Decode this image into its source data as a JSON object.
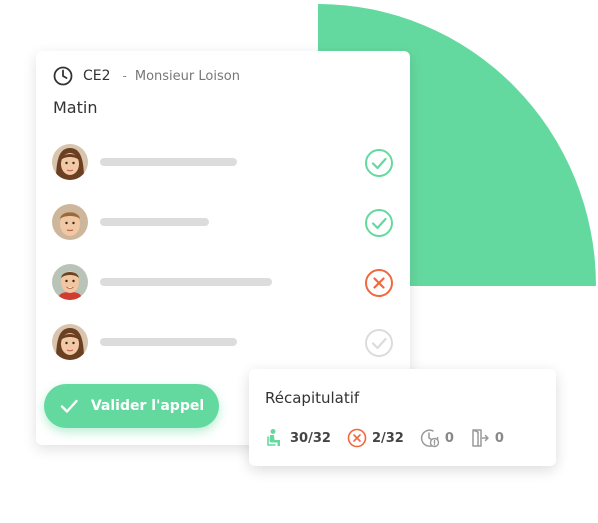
{
  "colors": {
    "accent": "#64d99f",
    "absent": "#f0693d",
    "muted": "#d6d6d6"
  },
  "card": {
    "class_name": "CE2",
    "separator": "-",
    "teacher": "Monsieur Loison",
    "period": "Matin",
    "students": [
      {
        "avatar": "child-avatar-girl",
        "status": "present"
      },
      {
        "avatar": "child-avatar-boy",
        "status": "present"
      },
      {
        "avatar": "child-avatar-boy",
        "status": "absent"
      },
      {
        "avatar": "child-avatar-girl",
        "status": "unmarked"
      }
    ],
    "validate_label": "Valider l'appel"
  },
  "summary": {
    "title": "Récapitulatif",
    "present": "30/32",
    "absent": "2/32",
    "late": "0",
    "left": "0"
  }
}
